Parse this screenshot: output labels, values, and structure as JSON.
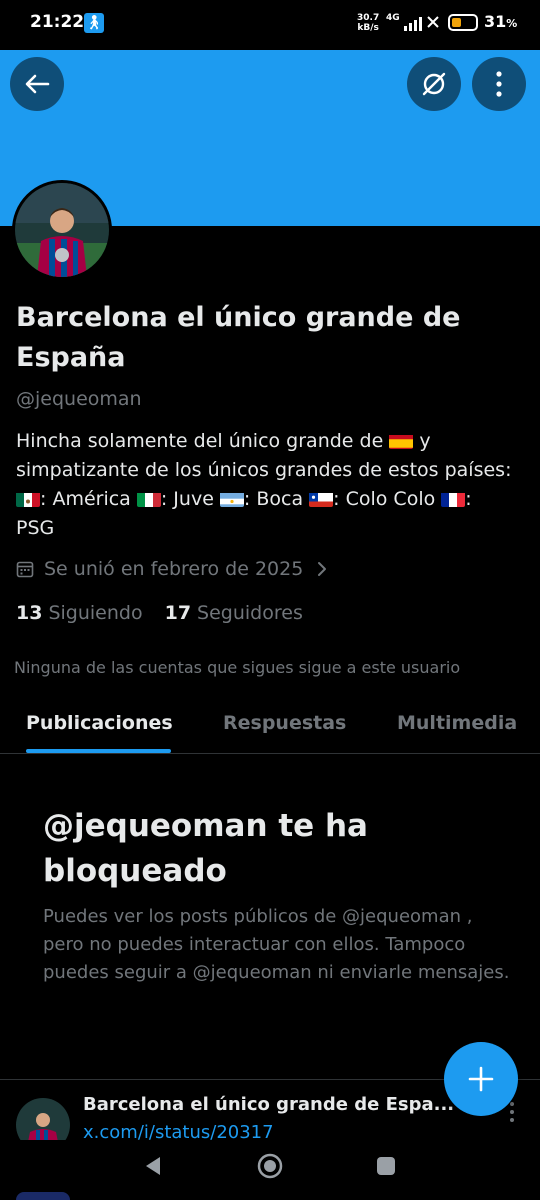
{
  "status_bar": {
    "time": "21:22",
    "speed_value": "30.7",
    "speed_unit": "kB/s",
    "network": "4G",
    "battery_percent": "31",
    "battery_suffix": "%"
  },
  "profile": {
    "name": "Barcelona el único grande de España",
    "handle": "@jequeoman",
    "bio": {
      "line1_text": "Hincha solamente del único grande de ",
      "line1_suffix": " y",
      "line2": "simpatizante de los únicos grandes de estos países:",
      "mexico_team": ": América ",
      "italy_team": ": Juve ",
      "argentina_team": ": Boca ",
      "chile_team": ": Colo Colo ",
      "france_team": ":",
      "last": "PSG"
    },
    "joined": "Se unió en febrero de 2025",
    "following_count": "13",
    "following_label": "Siguiendo",
    "followers_count": "17",
    "followers_label": "Seguidores",
    "mutuals_note": "Ninguna de las cuentas que sigues sigue a este usuario"
  },
  "tabs": [
    {
      "label": "Publicaciones",
      "active": true
    },
    {
      "label": "Respuestas",
      "active": false
    },
    {
      "label": "Multimedia",
      "active": false
    }
  ],
  "blocked": {
    "title": "@jequeoman te ha bloqueado",
    "description": "Puedes ver los posts públicos de @jequeoman , pero no puedes interactuar con ellos. Tampoco puedes seguir a @jequeoman ni enviarle mensajes."
  },
  "share_sheet": {
    "title": "Barcelona el único grande de Espa...",
    "link": "x.com/i/status/20317"
  },
  "colors": {
    "accent": "#1d9bf0",
    "banner": "#1d9bf0",
    "background": "#000000",
    "secondary_text": "#71767b"
  },
  "icons": [
    "back-arrow-icon",
    "grok-icon",
    "more-vertical-icon",
    "calendar-icon",
    "chevron-right-icon",
    "plus-icon",
    "nav-back-icon",
    "nav-home-icon",
    "nav-recents-icon"
  ]
}
